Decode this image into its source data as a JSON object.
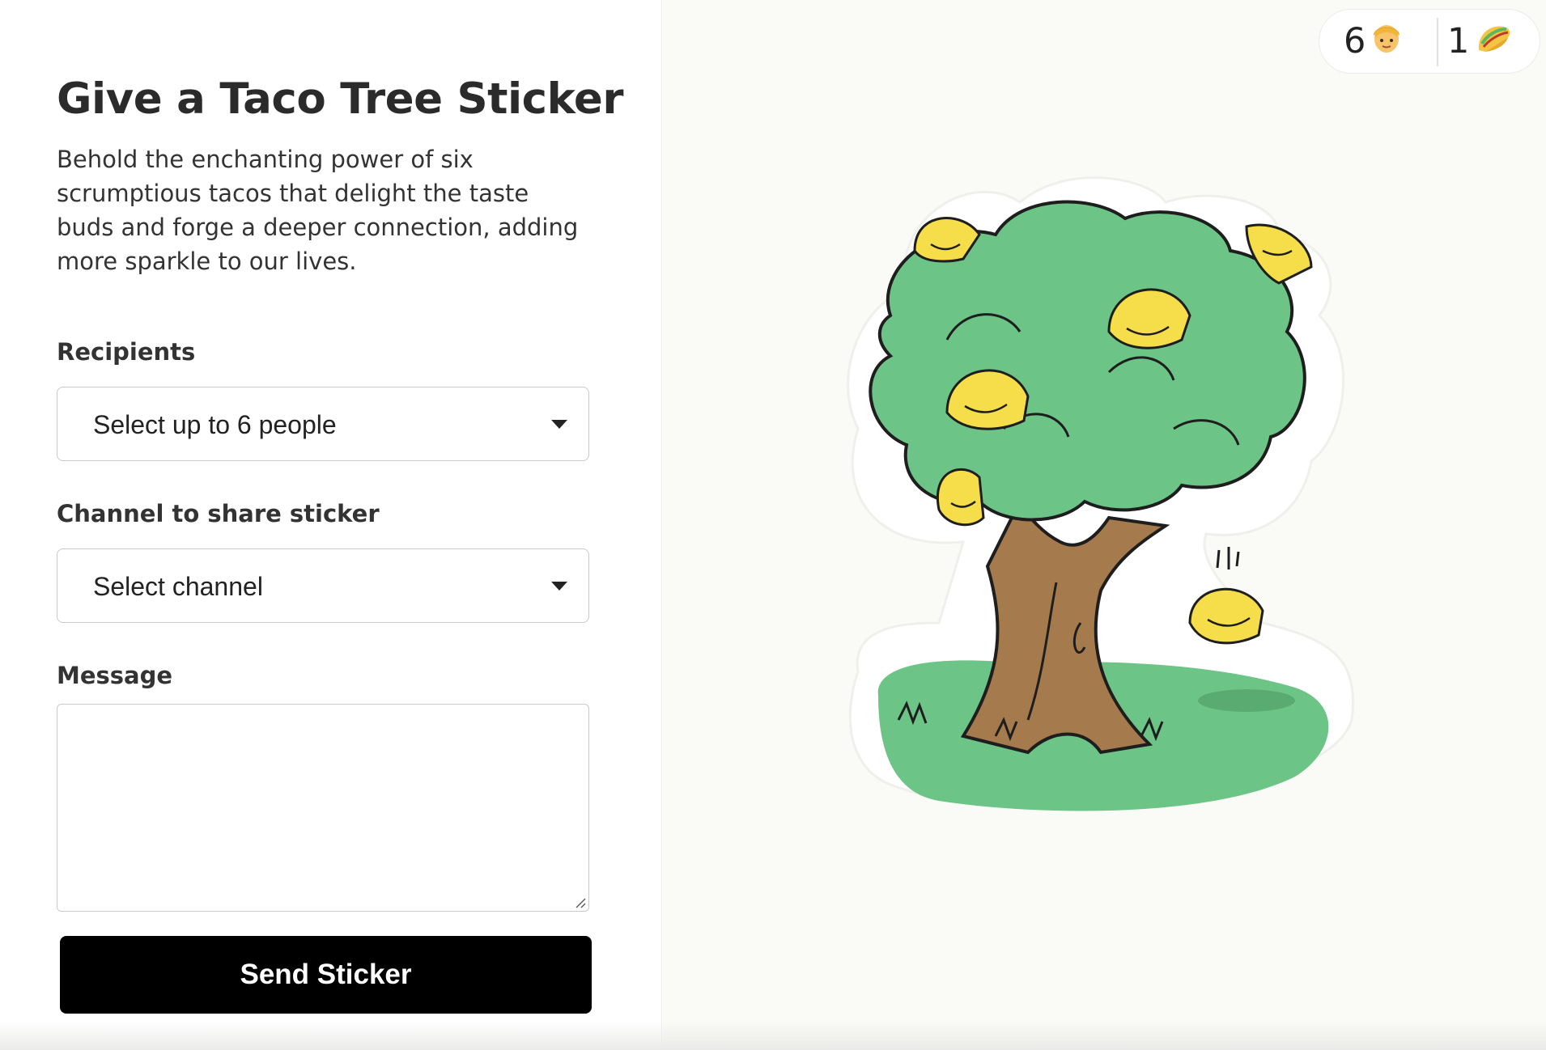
{
  "form": {
    "title": "Give a Taco Tree Sticker",
    "description": "Behold the enchanting power of six scrumptious tacos that delight the taste buds and forge a deeper connection, adding more sparkle to our lives.",
    "recipients": {
      "label": "Recipients",
      "placeholder": "Select up to 6 people"
    },
    "channel": {
      "label": "Channel to share sticker",
      "placeholder": "Select channel"
    },
    "message": {
      "label": "Message",
      "value": ""
    },
    "send_label": "Send Sticker"
  },
  "stats": {
    "people_count": "6",
    "people_icon": "person-emoji-icon",
    "taco_count": "1",
    "taco_icon": "taco-emoji-icon"
  },
  "illustration": {
    "name": "taco-tree-sticker",
    "colors": {
      "foliage": "#6cc587",
      "trunk": "#a57a4c",
      "grass": "#6cc587",
      "taco": "#f6dd4a",
      "outline": "#1e1e1e"
    }
  }
}
